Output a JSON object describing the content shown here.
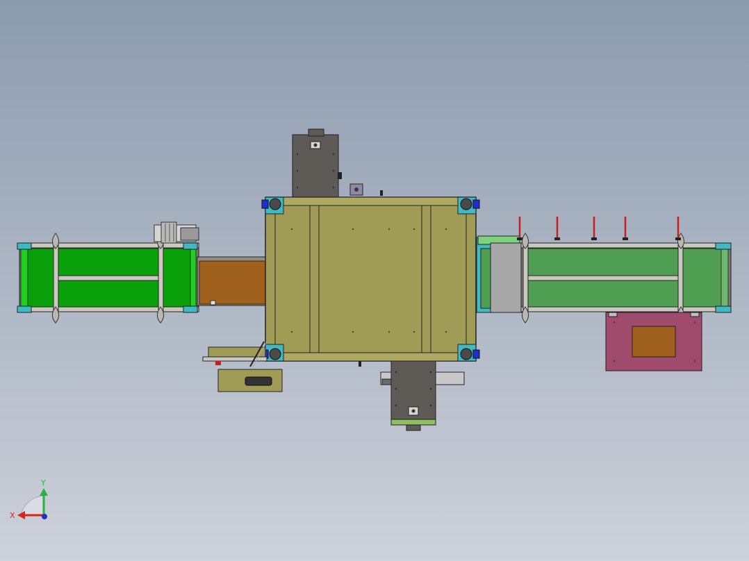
{
  "viewport": {
    "background_top": "#8c9bae",
    "background_bottom": "#cdd1da"
  },
  "triad": {
    "x_label": "X",
    "y_label": "Y",
    "x_color": "#e0201c",
    "y_color": "#28b43c",
    "z_color": "#2030c8"
  },
  "colors": {
    "bright_green": "#0aa00a",
    "muted_green": "#4f9e52",
    "olive": "#a09c55",
    "brown": "#a0601e",
    "magenta": "#a04a6c",
    "dark_gray": "#5e5b57",
    "cyan": "#3fb9c2",
    "red_rod": "#c81e1e",
    "blue_wheel": "#2030d0"
  }
}
